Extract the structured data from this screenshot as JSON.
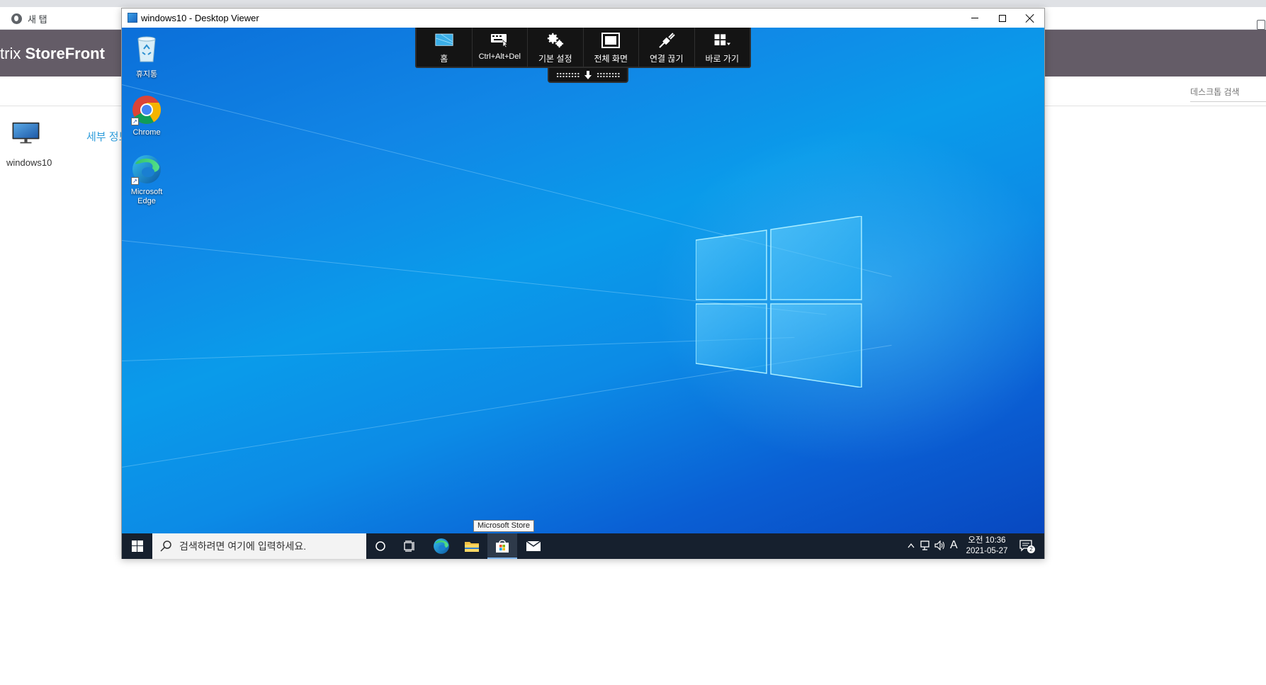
{
  "browser": {
    "bookmark_label": "새 탭"
  },
  "storefront": {
    "brand_light": "trix ",
    "brand_bold": "StoreFront",
    "search_placeholder": "데스크톱 검색",
    "app_name": "windows10",
    "details_link": "세부 정보"
  },
  "viewer": {
    "title": "windows10 - Desktop Viewer",
    "toolbar": [
      {
        "id": "home",
        "label": "홈",
        "icon": "monitor-home-icon"
      },
      {
        "id": "cad",
        "label": "Ctrl+Alt+Del",
        "icon": "keyboard-icon"
      },
      {
        "id": "prefs",
        "label": "기본 설정",
        "icon": "gears-icon"
      },
      {
        "id": "fullscreen",
        "label": "전체 화면",
        "icon": "fullscreen-icon"
      },
      {
        "id": "disconnect",
        "label": "연결 끊기",
        "icon": "plug-icon"
      },
      {
        "id": "shortcuts",
        "label": "바로 가기",
        "icon": "grid-icon"
      }
    ]
  },
  "desktop": {
    "icons": {
      "recycle": "휴지통",
      "chrome": "Chrome",
      "edge_line1": "Microsoft",
      "edge_line2": "Edge"
    },
    "tooltip": "Microsoft Store"
  },
  "taskbar": {
    "search_placeholder": "검색하려면 여기에 입력하세요.",
    "ime": "A",
    "time": "오전 10:36",
    "date": "2021-05-27",
    "notification_count": "2"
  },
  "colors": {
    "storefront_header": "#645c67",
    "accent_link": "#2d9cdb",
    "taskbar": "#16202e",
    "toolbar": "#141414"
  }
}
